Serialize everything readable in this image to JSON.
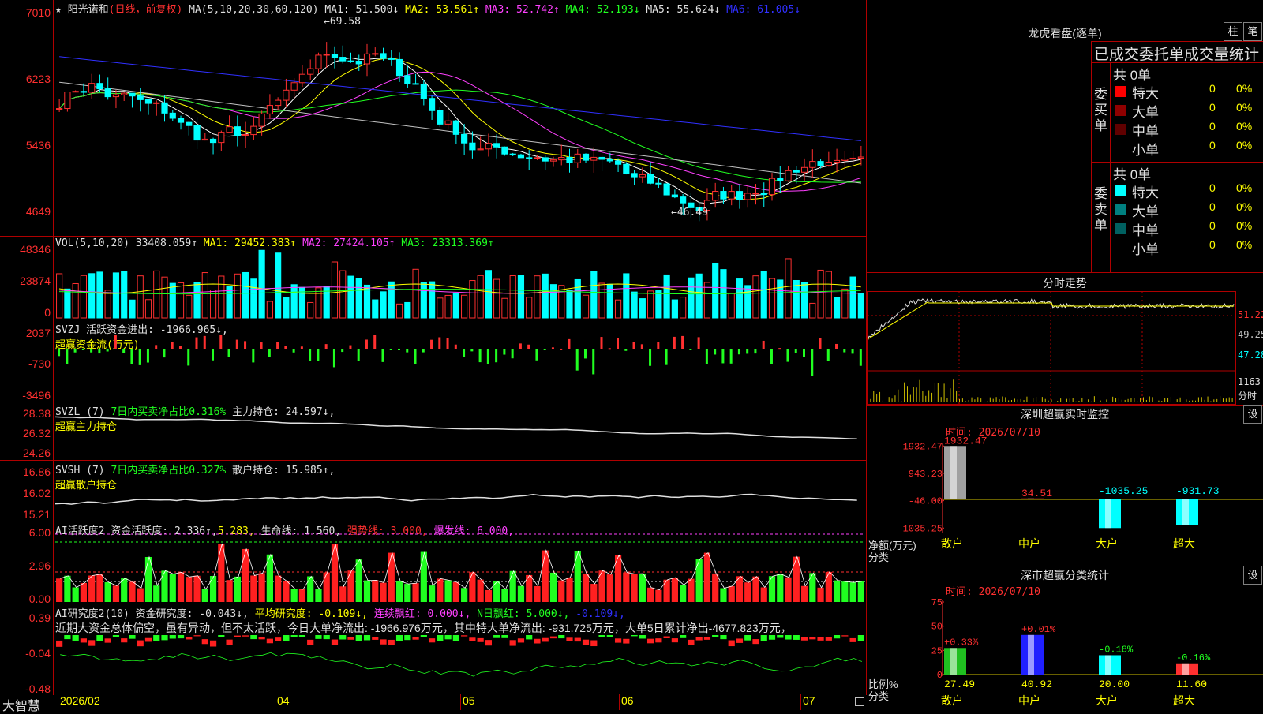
{
  "stock_name": "阳光诺和",
  "period": "(日线，前复权)",
  "colors": {
    "up": "#ff3030",
    "down": "#00ffff",
    "ma1": "#ffffff",
    "ma2": "#ffff00",
    "ma3": "#ff40ff",
    "ma4": "#20ff20",
    "ma5": "#c0c0c0",
    "ma6": "#3030ff",
    "grid": "#b00000"
  },
  "main": {
    "ma_label": "MA(5,10,20,30,60,120)",
    "ma": [
      {
        "label": "MA1: 51.500↓",
        "color": "white"
      },
      {
        "label": "MA2: 53.561↑",
        "color": "yellow"
      },
      {
        "label": "MA3: 52.742↑",
        "color": "mag"
      },
      {
        "label": "MA4: 52.193↓",
        "color": "green"
      },
      {
        "label": "MA5: 55.624↓",
        "color": "white"
      },
      {
        "label": "MA6: 61.005↓",
        "color": "blue"
      }
    ],
    "y_ticks": [
      "7010",
      "6223",
      "5436",
      "4649"
    ],
    "high_marker": "←69.58",
    "low_marker": "←46.49"
  },
  "vol": {
    "title": "VOL(5,10,20)",
    "value": "33408.059↑",
    "ma1": "MA1: 29452.383↑",
    "ma2": "MA2: 27424.105↑",
    "ma3": "MA3: 23313.369↑",
    "y_ticks": [
      "48346",
      "23874",
      "0"
    ]
  },
  "svzj": {
    "line1": "SVZJ  活跃资金进出: -1966.965↓,",
    "line2": "超赢资金流(万元)",
    "y_ticks": [
      "2037",
      "-730",
      "-3496"
    ]
  },
  "svzl": {
    "prefix": "SVZL (7)",
    "ratio": "7日内买卖净占比0.316%",
    "hold": "主力持仓: 24.597↓,",
    "line2": "超赢主力持仓",
    "y_ticks": [
      "28.38",
      "26.32",
      "24.26"
    ]
  },
  "svsh": {
    "prefix": "SVSH (7)",
    "ratio": "7日内买卖净占比0.327%",
    "hold": "散户持仓: 15.985↑,",
    "line2": "超赢散户持仓",
    "y_ticks": [
      "16.86",
      "16.02",
      "15.21"
    ]
  },
  "ai_act": {
    "p1": "AI活跃度2 资金活跃度: 2.336↑,",
    "p2": "5.283,",
    "p3": "生命线: 1.560,",
    "p4": "强势线: 3.000,",
    "p5": "爆发线: 6.000,",
    "y_ticks": [
      "6.00",
      "2.96",
      "0.00"
    ]
  },
  "ai_res": {
    "p1": "AI研究度2(10) 资金研究度: -0.043↓,",
    "p2": "平均研究度: -0.109↓,",
    "p3": "连续飘红: 0.000↓,",
    "p4": "N日飘红: 5.000↓,",
    "p5": "-0.109↓,",
    "comment": "近期大资金总体偏空，虽有异动，但不太活跃，今日大单净流出: -1966.976万元，其中特大单净流出: -931.725万元，大单5日累计净出-4677.823万元，",
    "y_ticks": [
      "0.39",
      "-0.04",
      "-0.48"
    ]
  },
  "x_axis": [
    "2026/02",
    "04",
    "05",
    "06",
    "07"
  ],
  "brand": "大智慧",
  "right": {
    "dragon_title": "龙虎看盘(逐单)",
    "btn1": "柱",
    "btn2": "笔",
    "stat_title": "已成交委托单成交量统计",
    "buy_side": "委买单",
    "sell_side": "委卖单",
    "buy_total": "共 0单",
    "sell_total": "共 0单",
    "buy_rows": [
      {
        "name": "特大",
        "val": "0",
        "pct": "0%",
        "color": "#ff0000"
      },
      {
        "name": "大单",
        "val": "0",
        "pct": "0%",
        "color": "#900000"
      },
      {
        "name": "中单",
        "val": "0",
        "pct": "0%",
        "color": "#600000"
      },
      {
        "name": "小单",
        "val": "0",
        "pct": "0%",
        "color": "#000000"
      }
    ],
    "sell_rows": [
      {
        "name": "特大",
        "val": "0",
        "pct": "0%",
        "color": "#00ffff"
      },
      {
        "name": "大单",
        "val": "0",
        "pct": "0%",
        "color": "#008080"
      },
      {
        "name": "中单",
        "val": "0",
        "pct": "0%",
        "color": "#006060"
      },
      {
        "name": "小单",
        "val": "0",
        "pct": "0%",
        "color": "#000000"
      }
    ],
    "intraday_title": "分时走势",
    "intraday_ticks": [
      "51.22",
      "49.25",
      "47.28",
      "1163"
    ],
    "intraday_unit": "分时",
    "monitor_title": "深圳超赢实时监控",
    "monitor_set": "设",
    "monitor_time": "时间: 2026/07/10",
    "monitor_y": [
      "1932.47",
      "943.23",
      "-46.00",
      "-1035.25"
    ],
    "monitor_ylabel1": "净额(万元)",
    "monitor_ylabel2": "分类",
    "stats_title": "深市超赢分类统计",
    "stats_set": "设",
    "stats_time": "时间: 2026/07/10",
    "stats_y": [
      "75",
      "50",
      "25",
      "0"
    ],
    "stats_ylabel1": "比例%",
    "stats_ylabel2": "分类"
  },
  "monitor_chart": {
    "type": "bar",
    "categories": [
      "散户",
      "中户",
      "大户",
      "超大"
    ],
    "values": [
      1932.47,
      34.51,
      -1035.25,
      -931.73
    ],
    "labels": [
      "1932.47",
      "34.51",
      "-1035.25",
      "-931.73"
    ]
  },
  "stats_chart": {
    "type": "bar",
    "categories": [
      "散户",
      "中户",
      "大户",
      "超大"
    ],
    "values": [
      27.49,
      40.92,
      20.0,
      11.6
    ],
    "labels": [
      "27.49",
      "40.92",
      "20.00",
      "11.60"
    ],
    "changes": [
      "+0.33%",
      "+0.01%",
      "-0.18%",
      "-0.16%"
    ]
  }
}
